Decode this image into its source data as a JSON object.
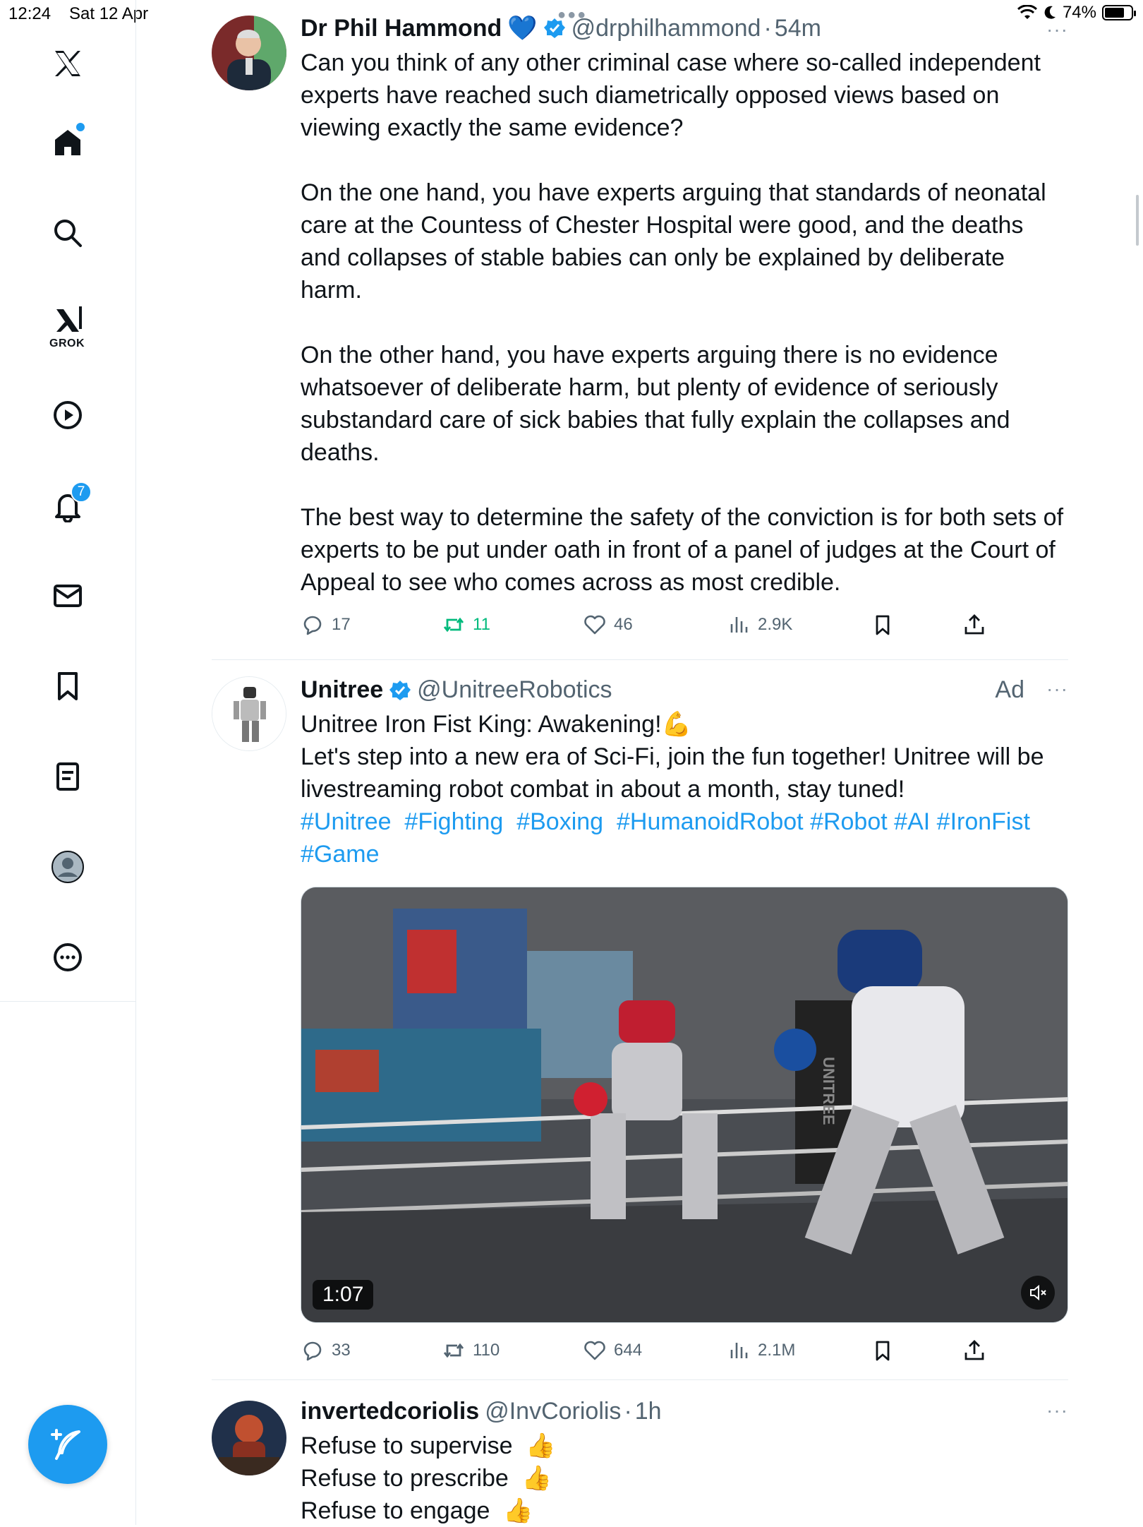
{
  "status_bar": {
    "time": "12:24",
    "date": "Sat 12 Apr",
    "battery": "74%",
    "battery_level": 0.74
  },
  "sidebar": {
    "grok_label": "GROK",
    "notifications_count": "7",
    "items": [
      "x-logo",
      "home-icon",
      "search-icon",
      "grok-icon",
      "video-icon",
      "notifications-icon",
      "messages-icon",
      "bookmarks-icon",
      "lists-icon",
      "profile-icon",
      "more-icon"
    ]
  },
  "colors": {
    "accent": "#1d9bf0",
    "retweet_active": "#00ba7c",
    "text_secondary": "#536471"
  },
  "tweets": [
    {
      "name": "Dr Phil Hammond",
      "name_emoji": "💙",
      "handle": "@drphilhammond",
      "separator": "·",
      "time": "54m",
      "paragraphs": [
        "Can you think of any other criminal case where so-called independent experts have reached such diametrically opposed views based on viewing exactly the same evidence?",
        "On the one hand, you have experts arguing that standards of neonatal care at the Countess of Chester Hospital were good, and the deaths and collapses of stable babies can only be explained by deliberate harm.",
        "On the other hand, you have experts arguing there is no evidence whatsoever of deliberate harm, but plenty of evidence of seriously substandard care of sick babies that fully explain the collapses and deaths.",
        "The best way to determine the safety of the conviction is for both sets of experts to be put under oath in front of a panel of judges at the Court of Appeal to see who comes across as most credible."
      ],
      "replies": "17",
      "retweets": "11",
      "likes": "46",
      "views": "2.9K"
    },
    {
      "name": "Unitree",
      "handle": "@UnitreeRobotics",
      "ad_label": "Ad",
      "line1": "Unitree Iron Fist King: Awakening!",
      "line1_emoji": "💪",
      "line2": "Let's step into a new era of Sci-Fi, join the fun together! Unitree will be livestreaming robot combat in about a month, stay tuned!",
      "hashtags": [
        "#Unitree",
        "#Fighting",
        "#Boxing",
        "#HumanoidRobot",
        "#Robot",
        "#AI",
        "#IronFist",
        "#Game"
      ],
      "video_duration": "1:07",
      "video_brand_text": "UNITREE",
      "replies": "33",
      "retweets": "110",
      "likes": "644",
      "views": "2.1M"
    },
    {
      "name": "invertedcoriolis",
      "handle": "@InvCoriolis",
      "separator": "·",
      "time": "1h",
      "lines": [
        "Refuse to supervise",
        "Refuse to prescribe",
        "Refuse to engage"
      ],
      "line_emoji": "👍"
    }
  ],
  "more_label": "···"
}
